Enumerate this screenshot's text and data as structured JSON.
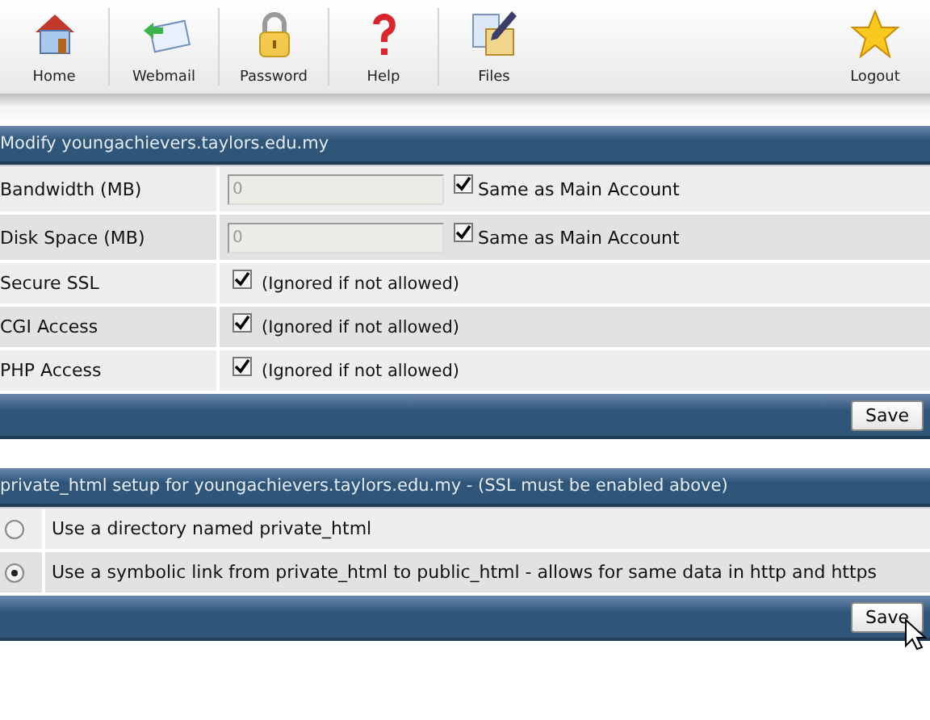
{
  "toolbar": [
    {
      "label": "Home",
      "kind": "home"
    },
    {
      "label": "Webmail",
      "kind": "mail"
    },
    {
      "label": "Password",
      "kind": "lock"
    },
    {
      "label": "Help",
      "kind": "help"
    },
    {
      "label": "Files",
      "kind": "files"
    },
    {
      "label": "Logout",
      "kind": "star"
    }
  ],
  "modify": {
    "title": "Modify youngachievers.taylors.edu.my",
    "rows": [
      {
        "kind": "quota",
        "label": "Bandwidth (MB)",
        "value": "0",
        "checked": true,
        "note": "Same as Main Account"
      },
      {
        "kind": "quota",
        "label": "Disk Space (MB)",
        "value": "0",
        "checked": true,
        "note": "Same as Main Account"
      },
      {
        "kind": "flag",
        "label": "Secure SSL",
        "checked": true,
        "note": "(Ignored if not allowed)"
      },
      {
        "kind": "flag",
        "label": "CGI Access",
        "checked": true,
        "note": "(Ignored if not allowed)"
      },
      {
        "kind": "flag",
        "label": "PHP Access",
        "checked": true,
        "note": "(Ignored if not allowed)"
      }
    ],
    "button": "Save"
  },
  "private_html": {
    "title": "private_html setup for youngachievers.taylors.edu.my - (SSL must be enabled above)",
    "options": [
      {
        "label": "Use a directory named private_html",
        "selected": false
      },
      {
        "label": "Use a symbolic link from private_html to public_html - allows for same data in http and https",
        "selected": true
      }
    ],
    "button": "Save"
  }
}
